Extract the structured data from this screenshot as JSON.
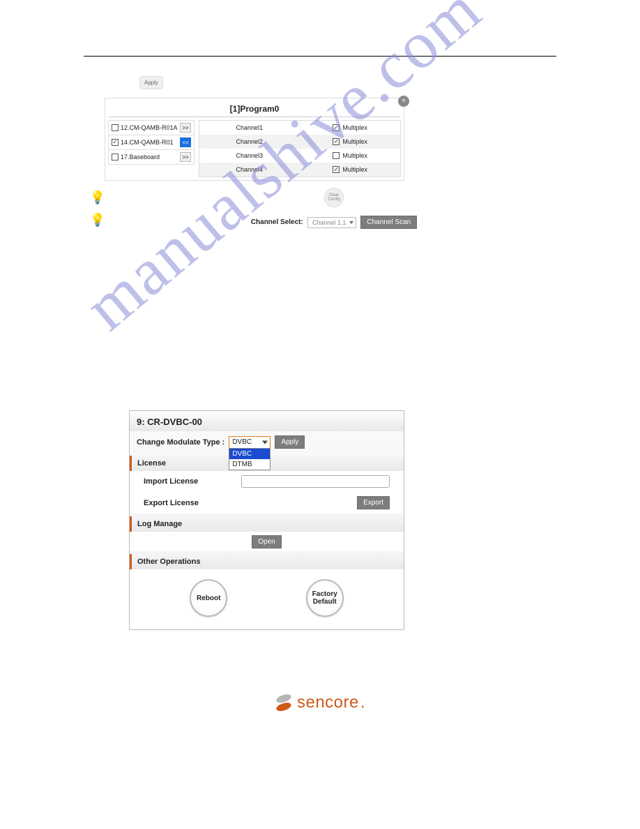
{
  "watermark": "manualshive.com",
  "apply_small": "Apply",
  "dialog": {
    "title": "[1]Program0",
    "close": "×",
    "sources": [
      {
        "label": "12.CM-QAMB-R01A",
        "checked": false,
        "btn": ">>",
        "btn_style": ""
      },
      {
        "label": "14.CM-QAMB-R01",
        "checked": true,
        "btn": "<<",
        "btn_style": "blue"
      },
      {
        "label": "17.Baseboard",
        "checked": false,
        "btn": ">>",
        "btn_style": ""
      }
    ],
    "channels": [
      {
        "name": "Channel1",
        "mux": true,
        "mux_label": "Multiplex"
      },
      {
        "name": "Channel2",
        "mux": true,
        "mux_label": "Multiplex"
      },
      {
        "name": "Channel3",
        "mux": false,
        "mux_label": "Multiplex"
      },
      {
        "name": "Channel4",
        "mux": true,
        "mux_label": "Multiplex"
      }
    ]
  },
  "clear_config": "Clear\nConfig",
  "channel_select": {
    "label": "Channel Select:",
    "value": "Channel 1.1",
    "scan": "Channel Scan"
  },
  "system": {
    "title": "9: CR-DVBC-00",
    "modulate_label": "Change Modulate Type :",
    "modulate_value": "DVBC",
    "modulate_options": [
      "DVBC",
      "DTMB"
    ],
    "apply": "Apply",
    "license_h": "License",
    "import_label": "Import License",
    "export_label": "Export License",
    "export_btn": "Export",
    "log_h": "Log Manage",
    "open": "Open",
    "other_h": "Other Operations",
    "reboot": "Reboot",
    "factory": "Factory\nDefault"
  },
  "footer_brand": "sencore",
  "footer_dot": "."
}
